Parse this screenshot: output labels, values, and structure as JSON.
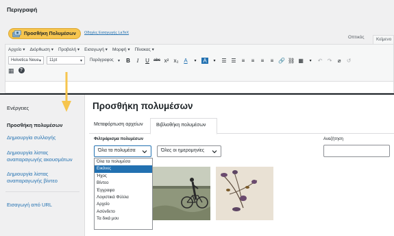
{
  "editor": {
    "panel_title": "Περιγραφή",
    "add_media_label": "Προσθήκη Πολυμέσων",
    "latex_link": "Οδηγίες Εισαγωγής LaTeX",
    "tab_visual": "Οπτικός",
    "tab_text": "Κείμενο",
    "menubar": [
      "Αρχείο ▾",
      "Διόρθωση ▾",
      "Προβολή ▾",
      "Εισαγωγή ▾",
      "Μορφή ▾",
      "Πίνακας ▾"
    ],
    "font_family": "Helvetica Neue",
    "font_size": "11pt",
    "paragraph": "Παράγραφος"
  },
  "modal": {
    "sidebar": {
      "actions_heading": "Ενέργειες",
      "items": [
        "Προσθήκη πολυμέσων",
        "Δημιουργία συλλογής",
        "Δημιουργία λίστας αναπαραγωγής ακουσμάτων",
        "Δημιουργία λίστας αναπαραγωγής βίντεο",
        "Εισαγωγή από URL"
      ]
    },
    "title": "Προσθήκη πολυμέσων",
    "tabs": [
      "Μεταφόρτωση αρχείων",
      "Βιβλιοθήκη πολυμέσων"
    ],
    "filter_label": "Φιλτράρισμα πολυμέσων",
    "search_label": "Αναζήτηση",
    "type_filter_value": "Όλα τα πολυμέσα",
    "date_filter_value": "Όλες οι ημερομηνίες",
    "type_options": [
      "Όλα τα πολυμέσα",
      "Εικόνες",
      "Ήχος",
      "Βίντεο",
      "Έγγραφα",
      "Λογιστικά Φύλλα",
      "Αρχείο",
      "Ασύνδετο",
      "Τα δικά μου"
    ],
    "selected_option_index": 1
  },
  "colors": {
    "accent": "#2271b1",
    "add_media_button": "#f6c54e",
    "arrow": "#f6c54e"
  }
}
